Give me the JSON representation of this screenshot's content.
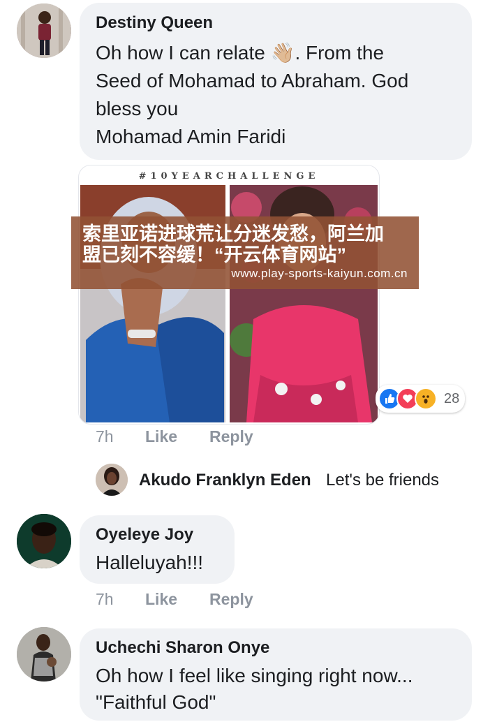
{
  "comments": [
    {
      "author": "Destiny Queen",
      "lines": [
        "Oh how I can relate 👋🏼. From the",
        "Seed of Mohamad to Abraham. God",
        "bless you",
        "Mohamad Amin Faridi"
      ],
      "photo_caption": "#10YEARCHALLENGE",
      "reaction_count": "28",
      "time": "7h",
      "like_label": "Like",
      "reply_label": "Reply"
    },
    {
      "reply_author": "Akudo Franklyn Eden",
      "reply_text": "Let's be friends"
    },
    {
      "author": "Oyeleye Joy",
      "text": "Halleluyah!!!",
      "time": "7h",
      "like_label": "Like",
      "reply_label": "Reply"
    },
    {
      "author": "Uchechi Sharon Onye",
      "lines": [
        "Oh how I feel like singing right now...",
        "\"Faithful God\""
      ]
    }
  ],
  "overlay": {
    "line1": "索里亚诺进球荒让分迷发愁，阿兰加",
    "line2": "盟已刻不容缓！“开云体育网站”",
    "url": "www.play-sports-kaiyun.com.cn"
  },
  "icons": {
    "like_reaction": "thumbs-up-icon",
    "love_reaction": "heart-icon",
    "wow_reaction": "wow-face-icon"
  },
  "colors": {
    "bubble": "#f0f2f5",
    "meta": "#8d949e",
    "like_blue": "#1877f2",
    "love_red": "#f33e58",
    "wow_yellow": "#f7b125"
  }
}
